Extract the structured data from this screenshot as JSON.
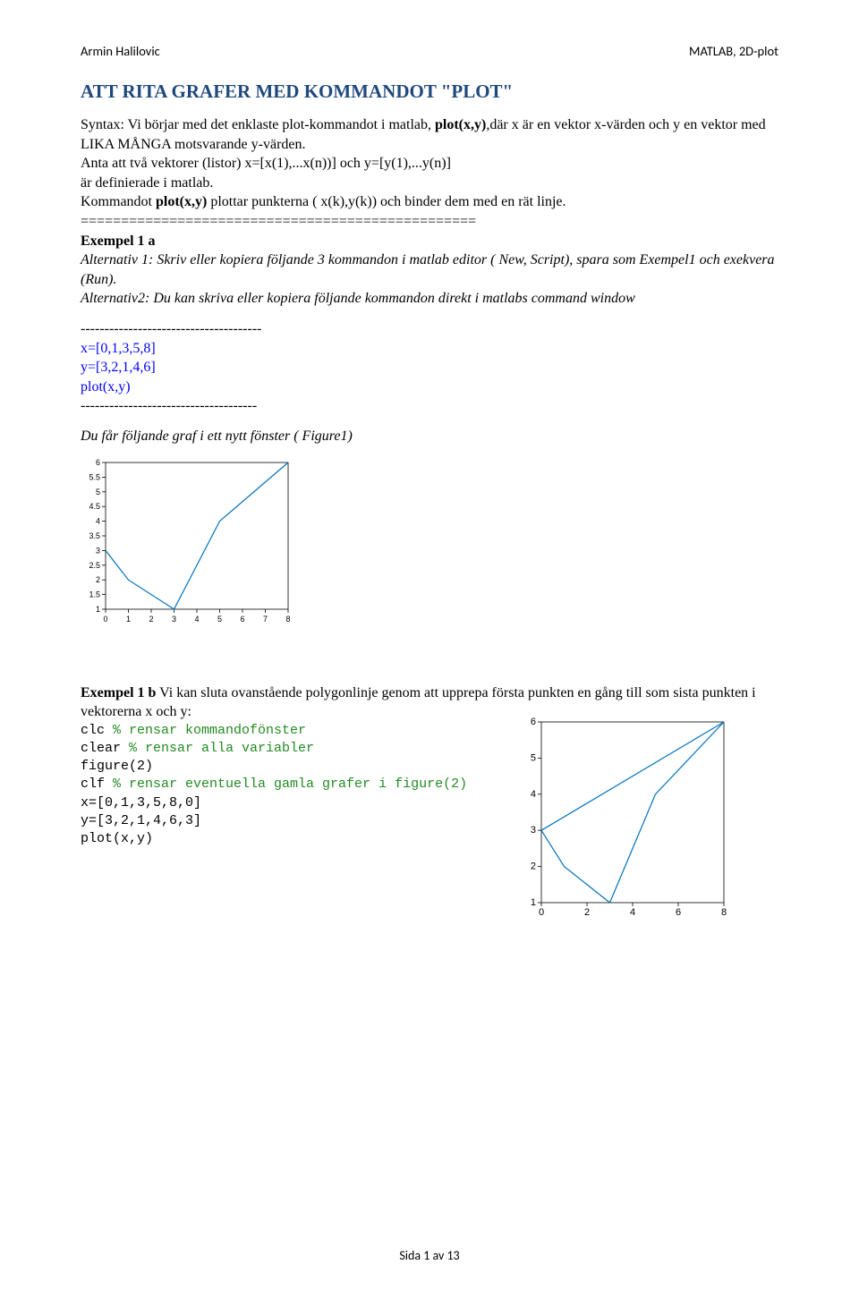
{
  "header": {
    "left": "Armin Halilovic",
    "right": "MATLAB, 2D-plot"
  },
  "title": "ATT RITA GRAFER MED KOMMANDOT \"PLOT\"",
  "para1_a": "Syntax: Vi börjar med det enklaste plot-kommandot i matlab, ",
  "para1_b": "plot(x,y)",
  "para1_c": ",där x är en vektor x-värden och y en vektor med LIKA MÅNGA motsvarande  y-värden.",
  "para2": "Anta att två vektorer (listor)  x=[x(1),...x(n))] och y=[y(1),...y(n)]",
  "para3": "är definierade i matlab.",
  "para4_a": "Kommandot ",
  "para4_b": "plot(x,y)",
  "para4_c": " plottar punkterna ( x(k),y(k))  och binder dem med en rät linje.",
  "divider1": "=================================================",
  "ex1a_heading": "Exempel 1 a",
  "ex1a_alt1": "Alternativ 1: Skriv eller kopiera  följande 3 kommandon  i matlab editor ( New, Script), spara som Exempel1 och exekvera (Run).",
  "ex1a_alt2": "Alternativ2: Du kan skriva eller kopiera följande kommandon direkt i matlabs command window",
  "dash1": "--------------------------------------",
  "code1_l1": "x=[0,1,3,5,8]",
  "code1_l2": "y=[3,2,1,4,6]",
  "code1_l3": "plot(x,y)",
  "dash2": "-------------------------------------",
  "result_caption": "Du får följande graf i ett nytt fönster ( Figure1)",
  "ex1b_para_a": "Exempel 1 b",
  "ex1b_para_b": " Vi kan sluta ovanstående  polygonlinje  genom att upprepa första punkten en gång till som sista punkten i vektorerna x och y:",
  "code2_l1a": "clc    ",
  "code2_l1b": "% rensar kommandofönster",
  "code2_l2a": "clear   ",
  "code2_l2b": "% rensar alla variabler",
  "code2_l3": "figure(2)",
  "code2_l4a": "clf   ",
  "code2_l4b": "% rensar eventuella gamla  grafer i figure(2)",
  "code2_l5": "x=[0,1,3,5,8,0]",
  "code2_l6": "y=[3,2,1,4,6,3]",
  "code2_l7": "plot(x,y)",
  "footer": "Sida 1 av 13",
  "chart_data": [
    {
      "type": "line",
      "x": [
        0,
        1,
        3,
        5,
        8
      ],
      "y": [
        3,
        2,
        1,
        4,
        6
      ],
      "xlim": [
        0,
        8
      ],
      "ylim": [
        1,
        6
      ],
      "xticks": [
        0,
        1,
        2,
        3,
        4,
        5,
        6,
        7,
        8
      ],
      "yticks": [
        1,
        1.5,
        2,
        2.5,
        3,
        3.5,
        4,
        4.5,
        5,
        5.5,
        6
      ],
      "xlabel": "",
      "ylabel": "",
      "title": ""
    },
    {
      "type": "line",
      "x": [
        0,
        1,
        3,
        5,
        8,
        0
      ],
      "y": [
        3,
        2,
        1,
        4,
        6,
        3
      ],
      "xlim": [
        0,
        8
      ],
      "ylim": [
        1,
        6
      ],
      "xticks": [
        0,
        2,
        4,
        6,
        8
      ],
      "yticks": [
        1,
        2,
        3,
        4,
        5,
        6
      ],
      "xlabel": "",
      "ylabel": "",
      "title": ""
    }
  ]
}
